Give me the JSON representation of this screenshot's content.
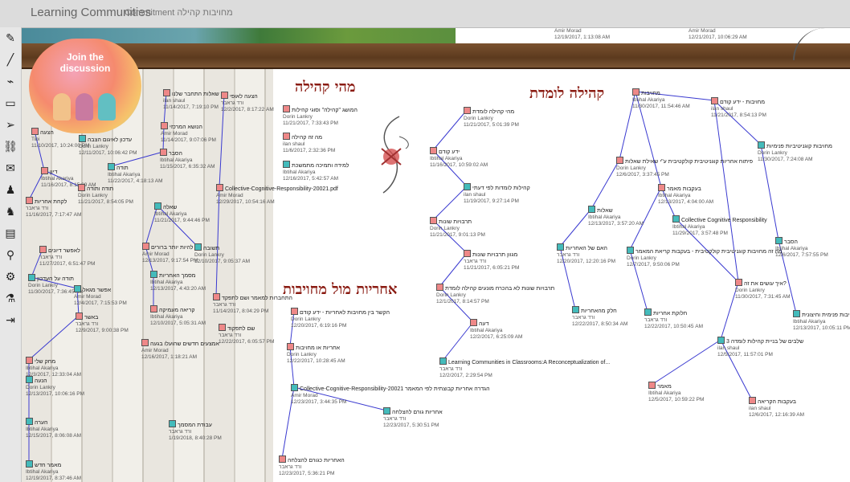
{
  "header": {
    "app_title": "Learning Communities",
    "view_title": "Commitment מחויבות קהילה"
  },
  "toolbar": {
    "items": [
      {
        "name": "pencil-icon",
        "glyph": "✎"
      },
      {
        "name": "line-icon",
        "glyph": "╱"
      },
      {
        "name": "paperclip-icon",
        "glyph": "⌁"
      },
      {
        "name": "window-icon",
        "glyph": "▭"
      },
      {
        "name": "arrow-icon",
        "glyph": "➢"
      },
      {
        "name": "link-icon",
        "glyph": "⛓"
      },
      {
        "name": "mail-icon",
        "glyph": "✉"
      },
      {
        "name": "person-icon",
        "glyph": "♟"
      },
      {
        "name": "people-icon",
        "glyph": "♞"
      },
      {
        "name": "calendar-icon",
        "glyph": "▤"
      },
      {
        "name": "search-icon",
        "glyph": "⚲"
      },
      {
        "name": "gear-icon",
        "glyph": "⚙"
      },
      {
        "name": "flask-icon",
        "glyph": "⚗"
      },
      {
        "name": "exit-icon",
        "glyph": "⇥"
      }
    ]
  },
  "banner": {
    "join_label": "Join the discussion"
  },
  "top_notes": [
    {
      "author": "Amir Morad",
      "date": "12/19/2017, 1:13:08 AM"
    },
    {
      "author": "Amir Morad",
      "date": "12/21/2017, 10:06:29 AM"
    }
  ],
  "headings": {
    "what_is_community": "מהי קהילה",
    "learning_community": "קהילה לומדת",
    "responsibility": "אחריות מול מחויבות"
  },
  "notes": [
    {
      "t": "שאלות התחבר שלנו",
      "a": "ilan shaul",
      "d": "11/14/2017, 7:19:10 PM",
      "c": "red"
    },
    {
      "t": "הצעה לאופי",
      "a": "ורד גראבר",
      "d": "12/2/2017, 8:17:22 AM",
      "c": "red"
    },
    {
      "t": "הנושא המרכזי",
      "a": "Amir Morad",
      "d": "11/14/2017, 9:07:06 PM",
      "c": "red"
    },
    {
      "t": "הצעה",
      "a": "Tibi",
      "d": "11/10/2017, 10:24:00 PM",
      "c": "red"
    },
    {
      "t": "עדכון לאיגום הצבה",
      "a": "Dorin Lankry",
      "d": "12/11/2017, 10:06:42 PM",
      "c": "teal"
    },
    {
      "t": "הסבר",
      "a": "Ibtihal Akariya",
      "d": "11/15/2017, 6:35:32 AM",
      "c": "red"
    },
    {
      "t": "תודה",
      "a": "Ibtihal Akariya",
      "d": "11/22/2017, 4:18:13 AM",
      "c": "teal"
    },
    {
      "t": "דיון",
      "a": "Ibtihal Akariya",
      "d": "11/16/2017, 8:15:09 AM",
      "c": "red"
    },
    {
      "t": "תודה ותודה",
      "a": "Dorin Lankry",
      "d": "11/21/2017, 8:54:05 PM",
      "c": "red"
    },
    {
      "t": "Collective-Cognitive-Responsibility-20021.pdf",
      "a": "Amir Morad",
      "d": "12/29/2017, 10:54:16 AM",
      "c": "red"
    },
    {
      "t": "לקחת אחריות",
      "a": "ורד גראבר",
      "d": "11/16/2017, 7:17:47 AM",
      "c": "red"
    },
    {
      "t": "שאלה",
      "a": "Ibtihal Akariya",
      "d": "11/21/2017, 9:44:46 PM",
      "c": "teal"
    },
    {
      "t": "להיות יותר ברורים",
      "a": "Amir Morad",
      "d": "12/13/2017, 9:17:54 PM",
      "c": "red"
    },
    {
      "t": "תשובה",
      "a": "Dorin Lankry",
      "d": "12/10/2017, 9:05:37 AM",
      "c": "teal"
    },
    {
      "t": "לאפשר דיונים",
      "a": "ורד גראבר",
      "d": "11/27/2017, 6:51:47 PM",
      "c": "red"
    },
    {
      "t": "מסמך האחריות",
      "a": "Ibtihal Akariya",
      "d": "12/13/2017, 4:43:20 AM",
      "c": "teal"
    },
    {
      "t": "תודה על העדכון",
      "a": "Dorin Lankry",
      "d": "11/30/2017, 7:36:45 AM",
      "c": "teal"
    },
    {
      "t": "אפשר מגאל",
      "a": "Amir Morad",
      "d": "12/4/2017, 7:15:53 PM",
      "c": "teal"
    },
    {
      "t": "התחברות למאמר ושם לתפקד",
      "a": "ורד גראבר",
      "d": "11/14/2017, 8:04:29 PM",
      "c": "red"
    },
    {
      "t": "קריאה מעמיקה",
      "a": "Ibtihal Akariya",
      "d": "12/10/2017, 5:05:31 AM",
      "c": "red"
    },
    {
      "t": "באשר",
      "a": "ורד גראבר",
      "d": "12/9/2017, 9:00:38 PM",
      "c": "red"
    },
    {
      "t": "שם לתפקוד",
      "a": "ורד גראבר",
      "d": "12/22/2017, 6:05:57 PM",
      "c": "red"
    },
    {
      "t": "אמצעים חדשים שהועלו בגעה",
      "a": "Amir Morad",
      "d": "12/16/2017, 1:18:21 AM",
      "c": "red"
    },
    {
      "t": "מחק שלי",
      "a": "Ibtihal Akariya",
      "d": "12/3/2017, 12:33:04 AM",
      "c": "red"
    },
    {
      "t": "הנעה",
      "a": "Dorin Lankry",
      "d": "12/13/2017, 10:06:16 PM",
      "c": "teal"
    },
    {
      "t": "הערה",
      "a": "Ibtihal Akariya",
      "d": "12/15/2017, 8:06:08 AM",
      "c": "teal"
    },
    {
      "t": "עבודת המסמך",
      "a": "ורד גראבר",
      "d": "1/19/2018, 8:40:28 PM",
      "c": "teal"
    },
    {
      "t": "מאמר חדש",
      "a": "Ibtihal Akariya",
      "d": "12/19/2017, 8:37:46 AM",
      "c": "teal"
    },
    {
      "t": "המושג \"קהילה\" וסוגי קהילות",
      "a": "Dorin Lankry",
      "d": "11/21/2017, 7:33:43 PM",
      "c": "red"
    },
    {
      "t": "מה זה קהילה",
      "a": "ilan shaul",
      "d": "11/6/2017, 2:32:36 PM",
      "c": "red"
    },
    {
      "t": "למידה ותמיכה מתמשכת",
      "a": "Ibtihal Akariya",
      "d": "12/16/2017, 5:42:57 AM",
      "c": "teal"
    },
    {
      "t": "מהי קהילה לומדת",
      "a": "Dorin Lankry",
      "d": "11/21/2017, 5:01:39 PM",
      "c": "red"
    },
    {
      "t": "ידע קודם",
      "a": "Ibtihal Akariya",
      "d": "11/16/2017, 10:59:02 AM",
      "c": "red"
    },
    {
      "t": "קהילות לומדות לפי דעתי",
      "a": "ilan shaul",
      "d": "11/19/2017, 9:27:14 PM",
      "c": "teal"
    },
    {
      "t": "תרבויות שונות",
      "a": "Dorin Lankry",
      "d": "11/21/2017, 9:01:13 PM",
      "c": "red"
    },
    {
      "t": "מגוון תרבויות שונות",
      "a": "ורד גראבר",
      "d": "11/21/2017, 6:05:21 PM",
      "c": "red"
    },
    {
      "t": "תרבויות שונות לא בהכרח מונעים קהילה לומדת",
      "a": "Dorin Lankry",
      "d": "12/1/2017, 8:14:57 PM",
      "c": "red"
    },
    {
      "t": "דעה",
      "a": "Ibtihal Akariya",
      "d": "12/2/2017, 6:25:09 AM",
      "c": "red"
    },
    {
      "t": "Learning Communities in Classrooms:A Reconceptualization of...",
      "a": "ורד גראבר",
      "d": "12/2/2017, 2:29:54 PM",
      "c": "teal"
    },
    {
      "t": "הקשר בין מחויבות לאחריות - ידע קודם",
      "a": "Dorin Lankry",
      "d": "12/20/2017, 6:19:16 PM",
      "c": "red"
    },
    {
      "t": "אחריות או מחויבות",
      "a": "Dorin Lankry",
      "d": "12/22/2017, 10:28:45 AM",
      "c": "red"
    },
    {
      "t": "Collective-Cognitive-Responsibility-20021 הגדרה אחריות קבוצתית לפי המאמר",
      "a": "Amir Morad",
      "d": "12/23/2017, 3:44:35 PM",
      "c": "teal"
    },
    {
      "t": "אחריות גורם להצלחה",
      "a": "ורד גראבר",
      "d": "12/23/2017, 5:30:51 PM",
      "c": "teal"
    },
    {
      "t": "האחריות כגורם להצלחה",
      "a": "ורד גראבר",
      "d": "12/23/2017, 5:36:21 PM",
      "c": "red"
    },
    {
      "t": "מחויבות",
      "a": "Ibtihal Akariya",
      "d": "11/30/2017, 11:54:46 AM",
      "c": "red"
    },
    {
      "t": "מחויבות - ידע קודם",
      "a": "ilan shaul",
      "d": "11/21/2017, 8:54:13 PM",
      "c": "red"
    },
    {
      "t": "פיתוח אחריות קוגניטיבית קולקטיבית ע\"י שאילת שאלות",
      "a": "Dorin Lankry",
      "d": "12/6/2017, 3:37:45 PM",
      "c": "red"
    },
    {
      "t": "מחויבות קוגניטיביות פנימיות",
      "a": "Dorin Lankry",
      "d": "11/30/2017, 7:24:08 AM",
      "c": "teal"
    },
    {
      "t": "בעקבות מאמר",
      "a": "Ibtihal Akariya",
      "d": "12/13/2017, 4:04:00 AM",
      "c": "red"
    },
    {
      "t": "שאלות",
      "a": "Ibtihal Akariya",
      "d": "12/13/2017, 3:57:20 AM",
      "c": "teal"
    },
    {
      "t": "Collective Cognitive Responsibility",
      "a": "Ibtihal Akariya",
      "d": "11/29/2017, 3:57:48 PM",
      "c": "teal"
    },
    {
      "t": "האם של האחריות",
      "a": "ורד גראבר",
      "d": "12/20/2017, 12:20:16 PM",
      "c": "teal"
    },
    {
      "t": "מה זה מחויבות קוגניטיבית קולקטיבית - בעקבות קריאת המאמר",
      "a": "Dorin Lankry",
      "d": "12/7/2017, 9:50:06 PM",
      "c": "teal"
    },
    {
      "t": "הסבר",
      "a": "Ibtihal Akariya",
      "d": "12/6/2017, 7:57:55 PM",
      "c": "teal"
    },
    {
      "t": "איך עושים את זה?",
      "a": "Dorin Lankry",
      "d": "11/30/2017, 7:31:45 AM",
      "c": "red"
    },
    {
      "t": "חלק מהאחריות",
      "a": "ורד גראבר",
      "d": "12/22/2017, 8:50:34 AM",
      "c": "teal"
    },
    {
      "t": "חלוקת אחריות",
      "a": "ורד גראבר",
      "d": "12/22/2017, 10:50:45 AM",
      "c": "teal"
    },
    {
      "t": "מחויבות פנימית וחיצונית",
      "a": "Ibtihal Akariya",
      "d": "12/13/2017, 10:05:11 PM",
      "c": "teal"
    },
    {
      "t": "שלבים של בניית קהילות לומדה 3",
      "a": "ilan shaul",
      "d": "12/5/2017, 11:57:01 PM",
      "c": "teal"
    },
    {
      "t": "מאמר",
      "a": "Ibtihal Akariya",
      "d": "12/5/2017, 10:59:22 PM",
      "c": "red"
    },
    {
      "t": "בעקבות הקריאה",
      "a": "ilan shaul",
      "d": "12/6/2017, 12:16:39 AM",
      "c": "red"
    }
  ]
}
